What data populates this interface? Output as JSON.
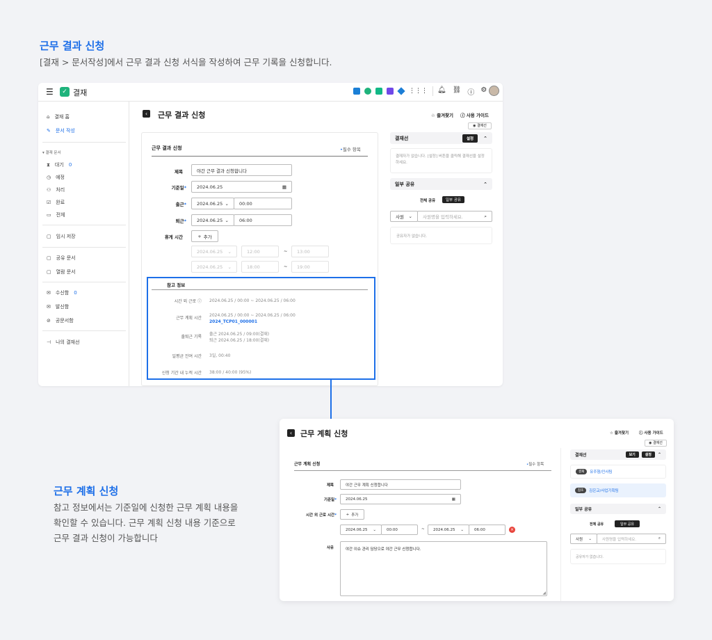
{
  "intro": {
    "title": "근무 결과 신청",
    "desc": "[결재 > 문서작성]에서 근무 결과 신청 서식을 작성하여 근무 기록을 신청합니다."
  },
  "app": {
    "name": "결재",
    "sidebar": {
      "home": "결재 홈",
      "write": "문서 작성",
      "section": "결재 문서",
      "items": [
        {
          "label": "대기",
          "count": "0"
        },
        {
          "label": "예정"
        },
        {
          "label": "처리"
        },
        {
          "label": "완료"
        },
        {
          "label": "전체"
        }
      ],
      "temp": "임시 저장",
      "shared": "공유 문서",
      "viewed": "열람 문서",
      "inbox": {
        "label": "수신함",
        "count": "0"
      },
      "outbox": "발신함",
      "official": "공문서함",
      "myline": "나의 결재선"
    }
  },
  "result_form": {
    "page_title": "근무 결과 신청",
    "favorite": "즐겨찾기",
    "guide": "사용 가이드",
    "approval_line_btn": "결재선",
    "form_title": "근무 결과 신청",
    "required_note": "필수 항목",
    "subject_label": "제목",
    "subject_value": "야간 근무 결과 신청합니다",
    "date_label": "기준일",
    "date_value": "2024.06.25",
    "start_label": "출근",
    "start_date": "2024.06.25",
    "start_time": "00:00",
    "end_label": "퇴근",
    "end_date": "2024.06.25",
    "end_time": "06:00",
    "break_label": "휴게 시간",
    "add_btn": "추가",
    "break_rows": [
      {
        "date": "2024.06.25",
        "from": "12:00",
        "to": "13:00"
      },
      {
        "date": "2024.06.25",
        "from": "18:00",
        "to": "19:00"
      }
    ],
    "tilde": "~",
    "ref": {
      "title": "참고 정보",
      "overtime_label": "시간 외 근로",
      "overtime_value": "2024.06.25 / 00:00 ~ 2024.06.25 / 06:00",
      "plan_label": "근무 계획 시간",
      "plan_value": "2024.06.25 / 00:00 ~ 2024.06.25 / 06:00",
      "plan_link": "2024_TCP01_000001",
      "commute_label": "출퇴근 기록",
      "commute_in": "출근 2024.06.25 / 09:00(결재)",
      "commute_out": "퇴근 2024.06.25 / 18:00(결재)",
      "avg_label": "일평균 잔여 시간",
      "avg_value": "3일, 00:40",
      "accum_label": "신청 기간 내 누적 시간",
      "accum_value": "38:00 / 40:00 (95%)"
    },
    "right": {
      "line_title": "결재선",
      "setting": "설정",
      "empty_line": "결재자가 없습니다. [설정] 버튼을 클릭해 결재선을 설정하세요.",
      "share_title": "일부 공유",
      "share_all": "전체 공유",
      "share_part": "일부 공유",
      "select": "사원",
      "search_ph": "사원명을 입력하세요.",
      "empty_share": "공유자가 없습니다."
    }
  },
  "plan_intro": {
    "title": "근무 계획 신청",
    "desc1": "참고 정보에서는 기준일에 신청한 근무 계획 내용을",
    "desc2": "확인할 수 있습니다. 근무 계획 신청 내용 기준으로",
    "desc3": "근무 결과 신청이 가능합니다"
  },
  "plan_form": {
    "page_title": "근무 계획 신청",
    "favorite": "즐겨찾기",
    "guide": "사용 가이드",
    "approval_line_btn": "결재선",
    "form_title": "근무 계획 신청",
    "required_note": "필수 항목",
    "subject_label": "제목",
    "subject_value": "야간 근무 계획 신청합니다",
    "date_label": "기준일",
    "date_value": "2024.06.25",
    "ot_label": "시간 외 근로 시간",
    "add_btn": "추가",
    "from_date": "2024.06.25",
    "from_time": "00:00",
    "to_date": "2024.06.25",
    "to_time": "06:00",
    "tilde": "~",
    "reason_label": "사유",
    "reason_value": "야간 이슈 관리 담당으로 야간 근무 신청합니다.",
    "right": {
      "line_title": "결재선",
      "view": "보기",
      "setting": "설정",
      "approver_tag": "결재",
      "approver_name": "유주형/인사팀",
      "ref_tag": "참조",
      "ref_name": "김은교/사업기획팀",
      "share_title": "일부 공유",
      "share_all": "전체 공유",
      "share_part": "일부 공유",
      "select": "사원",
      "search_ph": "사원명을 입력하세요.",
      "empty_share": "공유자가 없습니다."
    }
  },
  "colors": {
    "accent": "#1d6fe8",
    "app_green": "#1fb37c",
    "dark": "#222222"
  }
}
